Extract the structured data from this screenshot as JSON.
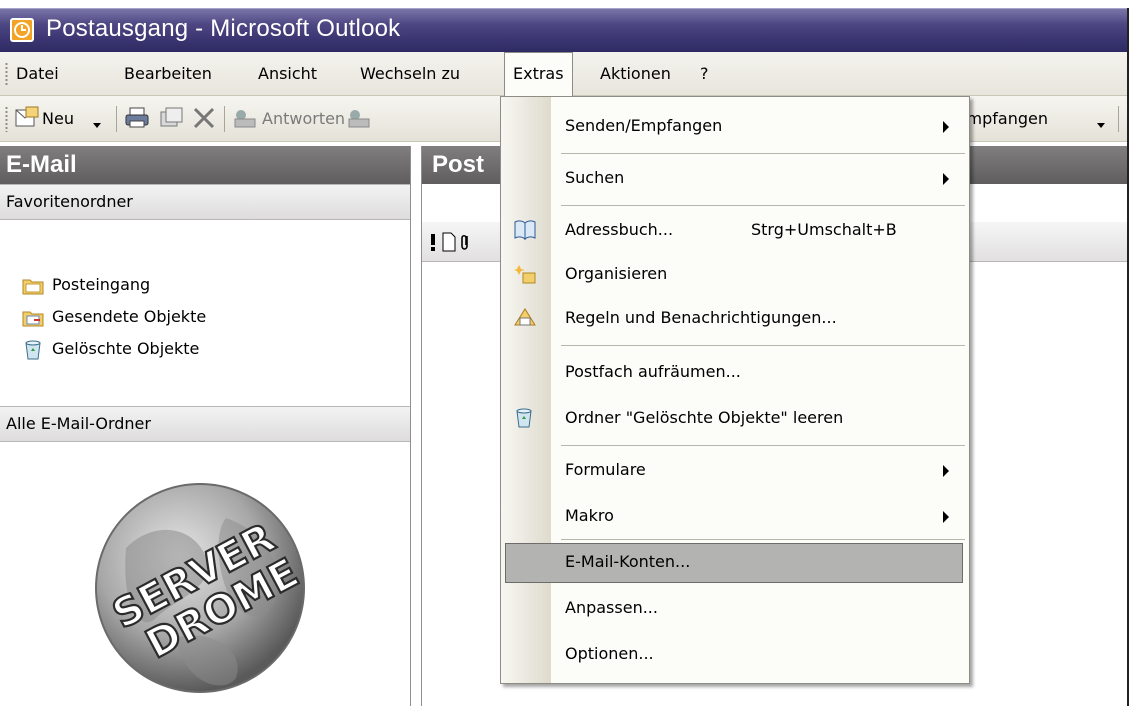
{
  "window": {
    "title": "Postausgang - Microsoft Outlook"
  },
  "menubar": {
    "items": [
      "Datei",
      "Bearbeiten",
      "Ansicht",
      "Wechseln zu",
      "Extras",
      "Aktionen",
      "?"
    ],
    "active": "Extras"
  },
  "toolbar": {
    "new_label": "Neu",
    "reply_label": "Antworten",
    "send_receive_label": "Senden/Empfangen"
  },
  "navigation": {
    "header": "E-Mail",
    "favorites_label": "Favoritenordner",
    "favorites": [
      {
        "label": "Posteingang",
        "icon": "inbox-folder-icon"
      },
      {
        "label": "Gesendete Objekte",
        "icon": "sent-folder-icon"
      },
      {
        "label": "Gelöschte Objekte",
        "icon": "trash-icon"
      }
    ],
    "all_folders_label": "Alle E-Mail-Ordner",
    "logo_text": [
      "SERVER",
      "DROME"
    ]
  },
  "mail_pane": {
    "header": "Post",
    "column_icons": [
      "importance-icon",
      "item-type-icon",
      "attachment-icon"
    ]
  },
  "extras_menu": {
    "items": [
      {
        "label": "Senden/Empfangen",
        "submenu": true
      },
      {
        "label": "Suchen",
        "submenu": true
      },
      {
        "label": "Adressbuch...",
        "shortcut": "Strg+Umschalt+B",
        "icon": "address-book-icon"
      },
      {
        "label": "Organisieren",
        "icon": "organize-icon"
      },
      {
        "label": "Regeln und Benachrichtigungen...",
        "icon": "rules-icon"
      },
      {
        "label": "Postfach aufräumen..."
      },
      {
        "label": "Ordner \"Gelöschte Objekte\" leeren",
        "icon": "trash-icon"
      },
      {
        "label": "Formulare",
        "submenu": true
      },
      {
        "label": "Makro",
        "submenu": true
      },
      {
        "label": "E-Mail-Konten...",
        "highlighted": true
      },
      {
        "label": "Anpassen..."
      },
      {
        "label": "Optionen..."
      }
    ]
  },
  "colors": {
    "titlebar": "#3b3672",
    "pane_header": "#6e6c6c",
    "menu_highlight": "#b3b3b1"
  }
}
